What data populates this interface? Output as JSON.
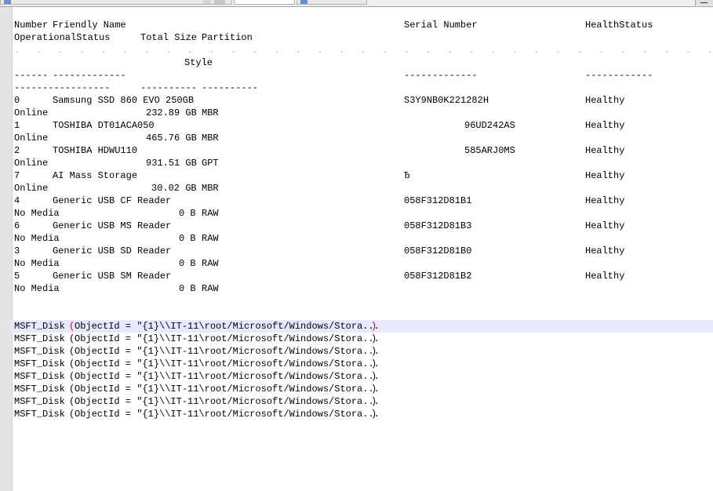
{
  "header_row1": {
    "number": "Number",
    "friendly_name": "Friendly Name",
    "serial_number": "Serial Number",
    "health_status": "HealthStatus"
  },
  "header_row2": {
    "operational_status": "OperationalStatus",
    "total_size": "Total Size",
    "partition": "Partition"
  },
  "header_row3": {
    "style": "Style"
  },
  "separators": {
    "number": "------",
    "friendly_name": "-------------",
    "serial_number": "-------------",
    "health_status": "------------",
    "operational_status": "-----------------",
    "total_size": "----------",
    "partition": "----------"
  },
  "dot_filler": ".  .  .  .  .  .  .  .  .  .  .  .  .  .  .  .  .  .  .  .  .  .  .  .  .  .  .  .  .  .  .  .  .  .  .  .  .  .  .  .  .  .  .  .  .  .  .  .  .  .  .  .  .  .  .  .  .  .  .  .  .  .  .  .  .",
  "disks": [
    {
      "number": "0",
      "friendly_name": "Samsung SSD 860 EVO 250GB",
      "serial": "S3Y9NB0K221282H",
      "health": "Healthy",
      "operational": "Online",
      "size": "232.89 GB",
      "partition": "MBR"
    },
    {
      "number": "1",
      "friendly_name": "TOSHIBA DT01ACA050",
      "serial": "96UD242AS",
      "health": "Healthy",
      "operational": "Online",
      "size": "465.76 GB",
      "partition": "MBR"
    },
    {
      "number": "2",
      "friendly_name": "TOSHIBA HDWU110",
      "serial": "585ARJ0MS",
      "health": "Healthy",
      "operational": "Online",
      "size": "931.51 GB",
      "partition": "GPT"
    },
    {
      "number": "7",
      "friendly_name": "AI Mass Storage",
      "serial": "Ђ",
      "health": "Healthy",
      "operational": "Online",
      "size": "30.02 GB",
      "partition": "MBR"
    },
    {
      "number": "4",
      "friendly_name": "Generic USB CF Reader",
      "serial": "058F312D81B1",
      "health": "Healthy",
      "operational": "No Media",
      "size": "0 B",
      "partition": "RAW"
    },
    {
      "number": "6",
      "friendly_name": "Generic USB MS Reader",
      "serial": "058F312D81B3",
      "health": "Healthy",
      "operational": "No Media",
      "size": "0 B",
      "partition": "RAW"
    },
    {
      "number": "3",
      "friendly_name": "Generic USB SD Reader",
      "serial": "058F312D81B0",
      "health": "Healthy",
      "operational": "No Media",
      "size": "0 B",
      "partition": "RAW"
    },
    {
      "number": "5",
      "friendly_name": "Generic USB SM Reader",
      "serial": "058F312D81B2",
      "health": "Healthy",
      "operational": "No Media",
      "size": "0 B",
      "partition": "RAW"
    }
  ],
  "msft_lines": [
    {
      "class_name": "MSFT_Disk",
      "open_paren": "(",
      "object_id": "ObjectId = \"{1}\\\\IT-11\\root/Microsoft/Windows/Stora...",
      "close_paren": ")"
    },
    {
      "class_name": "MSFT_Disk",
      "open_paren": "(",
      "object_id": "ObjectId = \"{1}\\\\IT-11\\root/Microsoft/Windows/Stora...",
      "close_paren": ")"
    },
    {
      "class_name": "MSFT_Disk",
      "open_paren": "(",
      "object_id": "ObjectId = \"{1}\\\\IT-11\\root/Microsoft/Windows/Stora...",
      "close_paren": ")"
    },
    {
      "class_name": "MSFT_Disk",
      "open_paren": "(",
      "object_id": "ObjectId = \"{1}\\\\IT-11\\root/Microsoft/Windows/Stora...",
      "close_paren": ")"
    },
    {
      "class_name": "MSFT_Disk",
      "open_paren": "(",
      "object_id": "ObjectId = \"{1}\\\\IT-11\\root/Microsoft/Windows/Stora...",
      "close_paren": ")"
    },
    {
      "class_name": "MSFT_Disk",
      "open_paren": "(",
      "object_id": "ObjectId = \"{1}\\\\IT-11\\root/Microsoft/Windows/Stora...",
      "close_paren": ")"
    },
    {
      "class_name": "MSFT_Disk",
      "open_paren": "(",
      "object_id": "ObjectId = \"{1}\\\\IT-11\\root/Microsoft/Windows/Stora...",
      "close_paren": ")"
    },
    {
      "class_name": "MSFT_Disk",
      "open_paren": "(",
      "object_id": "ObjectId = \"{1}\\\\IT-11\\root/Microsoft/Windows/Stora...",
      "close_paren": ")"
    }
  ],
  "colors": {
    "current_line": "#e8e8ff",
    "brace_match": "#e00000",
    "gutter": "#e4e4e4"
  }
}
